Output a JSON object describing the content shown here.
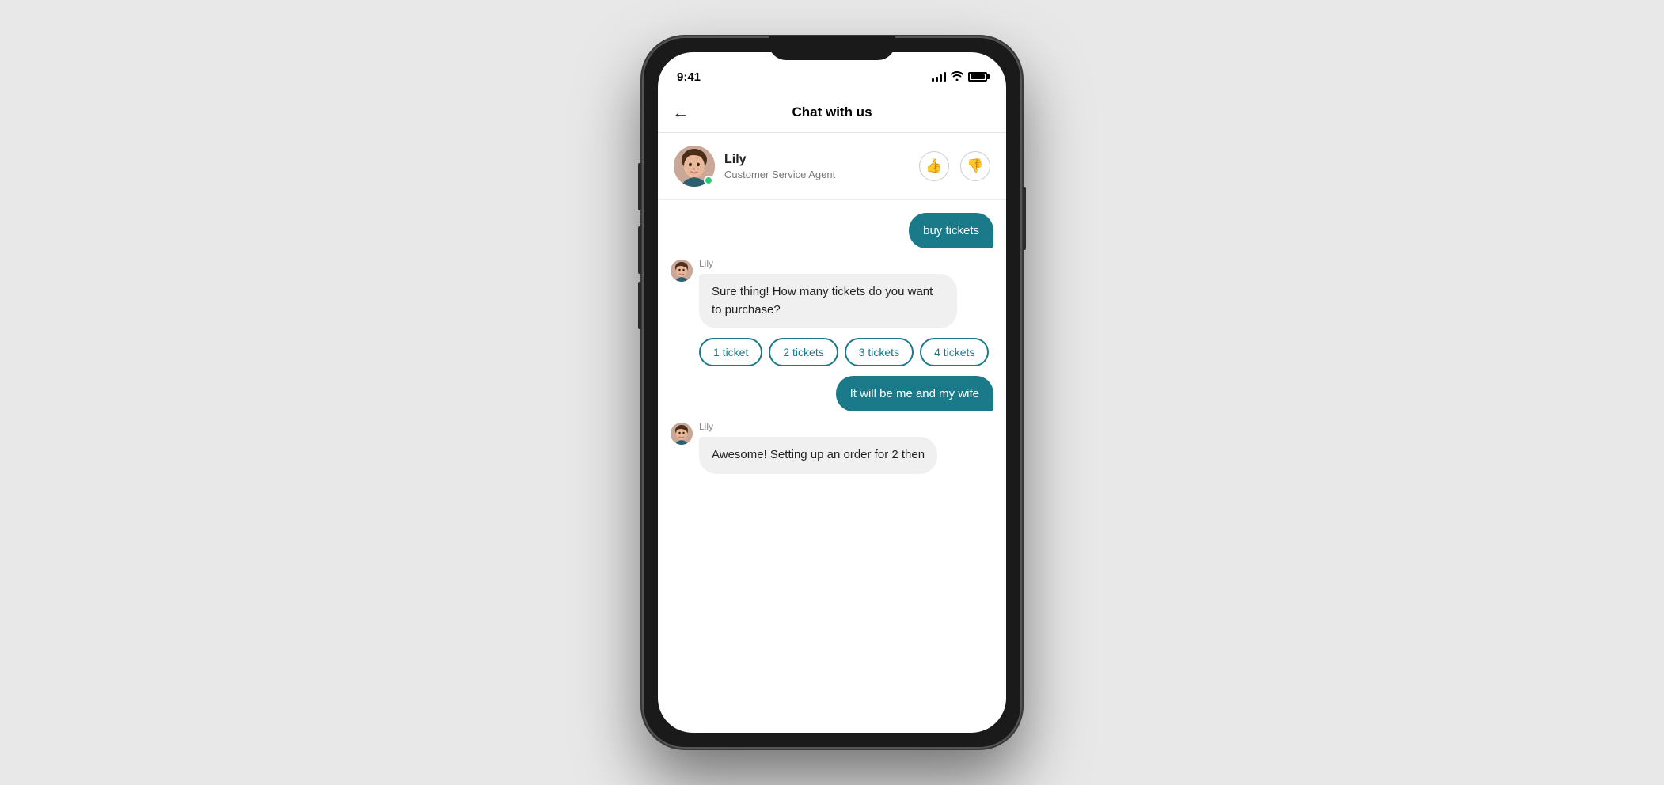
{
  "phone": {
    "status_bar": {
      "time": "9:41"
    },
    "nav": {
      "title": "Chat with us",
      "back_label": "←"
    },
    "agent": {
      "name": "Lily",
      "role": "Customer Service Agent",
      "thumbs_up_label": "👍",
      "thumbs_down_label": "👎"
    },
    "messages": [
      {
        "type": "user",
        "text": "buy tickets"
      },
      {
        "type": "agent",
        "sender": "Lily",
        "text": "Sure thing! How many tickets do you want to purchase?"
      },
      {
        "type": "quick_replies",
        "options": [
          "1 ticket",
          "2 tickets",
          "3 tickets",
          "4 tickets"
        ]
      },
      {
        "type": "user",
        "text": "It will be me and my wife"
      },
      {
        "type": "agent",
        "sender": "Lily",
        "text": "Awesome! Setting up an order for 2 then"
      }
    ]
  }
}
